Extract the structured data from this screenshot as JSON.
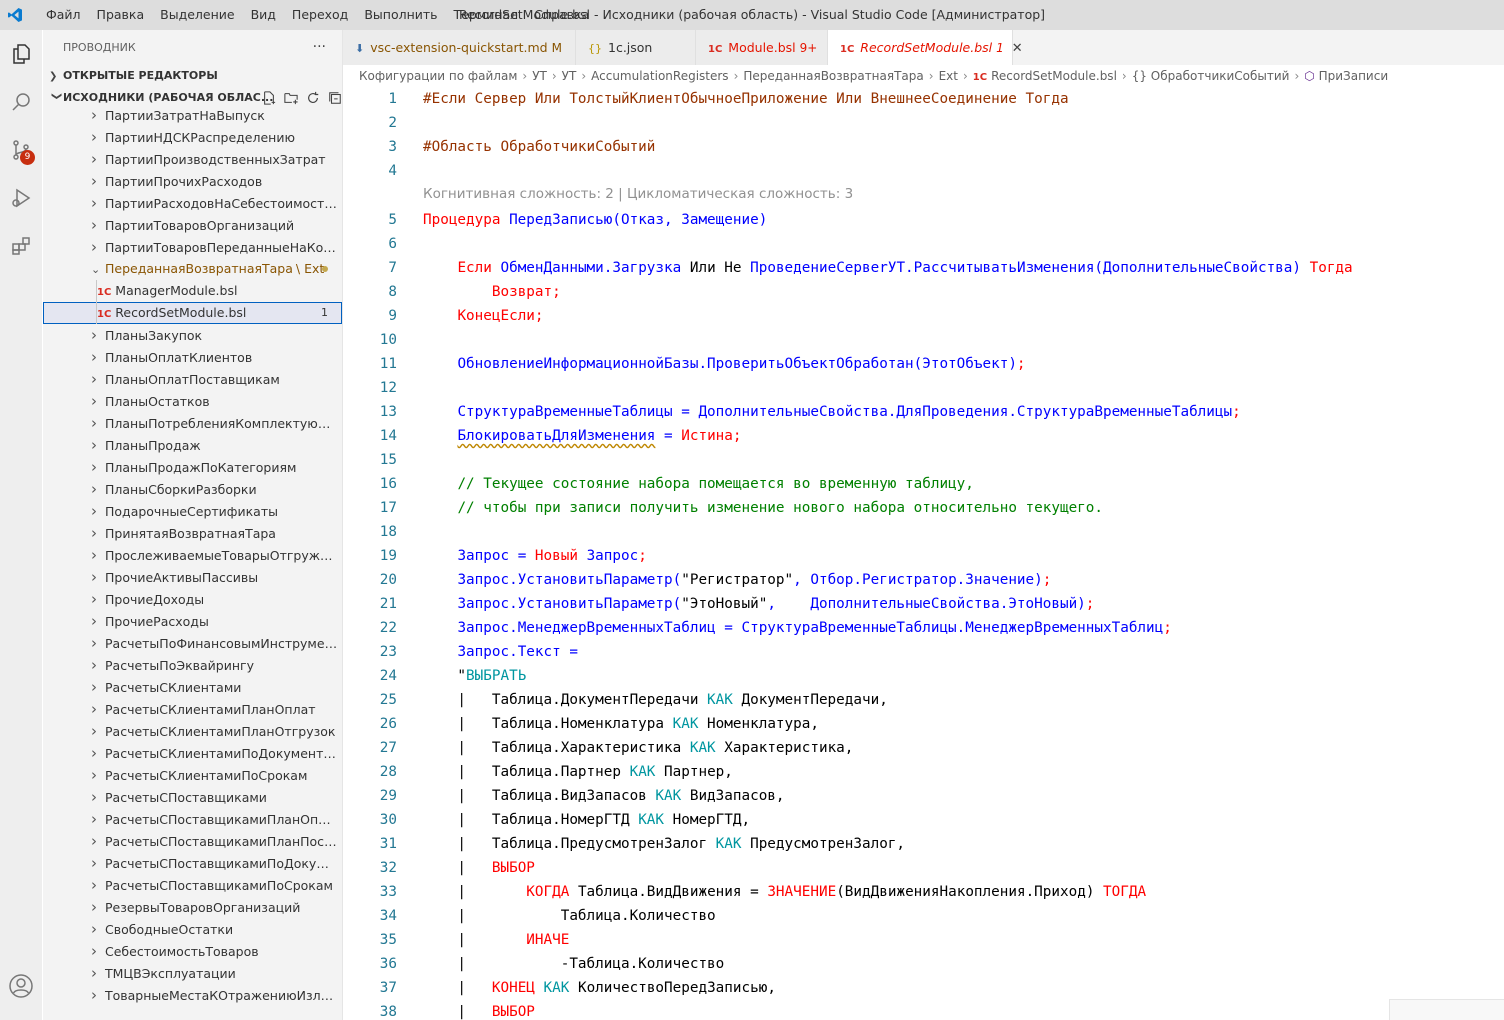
{
  "titlebar": {
    "menu": [
      "Файл",
      "Правка",
      "Выделение",
      "Вид",
      "Переход",
      "Выполнить",
      "Терминал",
      "Справка"
    ],
    "title": "RecordSetModule.bsl - Исходники (рабочая область) - Visual Studio Code [Администратор]"
  },
  "activity": {
    "scm_badge": "9"
  },
  "sidebar": {
    "title": "ПРОВОДНИК",
    "open_editors": "ОТКРЫТЫЕ РЕДАКТОРЫ",
    "workspace": "ИСХОДНИКИ (РАБОЧАЯ ОБЛАС...",
    "items": [
      {
        "label": "ПартииЗатратНаВыпуск",
        "kind": "folder"
      },
      {
        "label": "ПартииНДСКРаспределению",
        "kind": "folder"
      },
      {
        "label": "ПартииПроизводственныхЗатрат",
        "kind": "folder"
      },
      {
        "label": "ПартииПрочихРасходов",
        "kind": "folder"
      },
      {
        "label": "ПартииРасходовНаСебестоимостьТо...",
        "kind": "folder"
      },
      {
        "label": "ПартииТоваровОрганизаций",
        "kind": "folder"
      },
      {
        "label": "ПартииТоваровПереданныеНаКомис...",
        "kind": "folder"
      },
      {
        "label": "ПереданнаяВозвратнаяТара",
        "kind": "open-folder",
        "suffix": "\\ Ext"
      },
      {
        "label": "ManagerModule.bsl",
        "kind": "file"
      },
      {
        "label": "RecordSetModule.bsl",
        "kind": "file-selected",
        "count": "1"
      },
      {
        "label": "ПланыЗакупок",
        "kind": "folder"
      },
      {
        "label": "ПланыОплатКлиентов",
        "kind": "folder"
      },
      {
        "label": "ПланыОплатПоставщикам",
        "kind": "folder"
      },
      {
        "label": "ПланыОстатков",
        "kind": "folder"
      },
      {
        "label": "ПланыПотребленияКомплектующих",
        "kind": "folder"
      },
      {
        "label": "ПланыПродаж",
        "kind": "folder"
      },
      {
        "label": "ПланыПродажПоКатегориям",
        "kind": "folder"
      },
      {
        "label": "ПланыСборкиРазборки",
        "kind": "folder"
      },
      {
        "label": "ПодарочныеСертификаты",
        "kind": "folder"
      },
      {
        "label": "ПринятаяВозвратнаяТара",
        "kind": "folder"
      },
      {
        "label": "ПрослеживаемыеТоварыОтгруженн...",
        "kind": "folder"
      },
      {
        "label": "ПрочиеАктивыПассивы",
        "kind": "folder"
      },
      {
        "label": "ПрочиеДоходы",
        "kind": "folder"
      },
      {
        "label": "ПрочиеРасходы",
        "kind": "folder"
      },
      {
        "label": "РасчетыПоФинансовымИнструментам",
        "kind": "folder"
      },
      {
        "label": "РасчетыПоЭквайрингу",
        "kind": "folder"
      },
      {
        "label": "РасчетыСКлиентами",
        "kind": "folder"
      },
      {
        "label": "РасчетыСКлиентамиПланОплат",
        "kind": "folder"
      },
      {
        "label": "РасчетыСКлиентамиПланОтгрузок",
        "kind": "folder"
      },
      {
        "label": "РасчетыСКлиентамиПоДокументам",
        "kind": "folder"
      },
      {
        "label": "РасчетыСКлиентамиПоСрокам",
        "kind": "folder"
      },
      {
        "label": "РасчетыСПоставщиками",
        "kind": "folder"
      },
      {
        "label": "РасчетыСПоставщикамиПланОплат",
        "kind": "folder"
      },
      {
        "label": "РасчетыСПоставщикамиПланПоставок",
        "kind": "folder"
      },
      {
        "label": "РасчетыСПоставщикамиПоДокумент...",
        "kind": "folder"
      },
      {
        "label": "РасчетыСПоставщикамиПоСрокам",
        "kind": "folder"
      },
      {
        "label": "РезервыТоваровОрганизаций",
        "kind": "folder"
      },
      {
        "label": "СвободныеОстатки",
        "kind": "folder"
      },
      {
        "label": "СебестоимостьТоваров",
        "kind": "folder"
      },
      {
        "label": "ТМЦВЭксплуатации",
        "kind": "folder"
      },
      {
        "label": "ТоварныеМестаКОтражениюИзлишк...",
        "kind": "folder"
      }
    ]
  },
  "tabs": [
    {
      "label": "vsc-extension-quickstart.md",
      "flag": "M",
      "icon": "download-icon"
    },
    {
      "label": "1c.json",
      "flag": "",
      "icon": "json-icon"
    },
    {
      "label": "Module.bsl",
      "flag": "9+",
      "icon": "onec-icon"
    },
    {
      "label": "RecordSetModule.bsl",
      "flag": "1",
      "icon": "onec-icon",
      "active": true
    }
  ],
  "breadcrumb": [
    "Кофигурации по файлам",
    "УТ",
    "УТ",
    "AccumulationRegisters",
    "ПереданнаяВозвратнаяТара",
    "Ext",
    "RecordSetModule.bsl",
    "{} ОбработчикиСобытий",
    "ПриЗаписи"
  ],
  "editor": {
    "codelens": "Когнитивная сложность: 2 | Цикломатическая сложность: 3",
    "lines": [
      {
        "n": "1",
        "t": [
          [
            "k-pre",
            "#Если Сервер Или ТолстыйКлиентОбычноеПриложение Или ВнешнееСоединение Тогда"
          ]
        ]
      },
      {
        "n": "2",
        "t": []
      },
      {
        "n": "3",
        "t": [
          [
            "k-pre",
            "#Область ОбработчикиСобытий"
          ]
        ]
      },
      {
        "n": "4",
        "t": []
      },
      {
        "n": "5",
        "t": [
          [
            "k-red",
            "Процедура "
          ],
          [
            "k-blue",
            "ПередЗаписью(Отказ, Замещение)"
          ]
        ]
      },
      {
        "n": "6",
        "t": []
      },
      {
        "n": "7",
        "t": [
          [
            "k-dark",
            "    "
          ],
          [
            "k-red",
            "Если "
          ],
          [
            "k-blue",
            "ОбменДанными.Загрузка "
          ],
          [
            "k-dark",
            "Или Не "
          ],
          [
            "k-blue",
            "ПроведениеСервerУТ.РассчитыватьИзменения(ДополнительныеСвойства) "
          ],
          [
            "k-red",
            "Тогда"
          ]
        ]
      },
      {
        "n": "8",
        "t": [
          [
            "k-dark",
            "        "
          ],
          [
            "k-red",
            "Возврат;"
          ]
        ]
      },
      {
        "n": "9",
        "t": [
          [
            "k-dark",
            "    "
          ],
          [
            "k-red",
            "КонецЕсли;"
          ]
        ]
      },
      {
        "n": "10",
        "t": []
      },
      {
        "n": "11",
        "t": [
          [
            "k-dark",
            "    "
          ],
          [
            "k-blue",
            "ОбновлениеИнформационнойБазы.ПроверитьОбъектОбработан(ЭтотОбъект)"
          ],
          [
            "k-red",
            ";"
          ]
        ]
      },
      {
        "n": "12",
        "t": []
      },
      {
        "n": "13",
        "t": [
          [
            "k-dark",
            "    "
          ],
          [
            "k-blue",
            "СтруктураВременныеТаблицы = ДополнительныеСвойства.ДляПроведения.СтруктураВременныеТаблицы"
          ],
          [
            "k-red",
            ";"
          ]
        ]
      },
      {
        "n": "14",
        "t": [
          [
            "k-dark",
            "    "
          ],
          [
            "k-blue squiggle",
            "БлокироватьДляИзменения"
          ],
          [
            "k-blue",
            " = "
          ],
          [
            "k-red",
            "Истина;"
          ]
        ]
      },
      {
        "n": "15",
        "t": []
      },
      {
        "n": "16",
        "t": [
          [
            "k-dark",
            "    "
          ],
          [
            "k-green",
            "// Текущее состояние набора помещается во временную таблицу,"
          ]
        ]
      },
      {
        "n": "17",
        "t": [
          [
            "k-dark",
            "    "
          ],
          [
            "k-green",
            "// чтобы при записи получить изменение нового набора относительно текущего."
          ]
        ]
      },
      {
        "n": "18",
        "t": []
      },
      {
        "n": "19",
        "t": [
          [
            "k-dark",
            "    "
          ],
          [
            "k-blue",
            "Запрос = "
          ],
          [
            "k-red",
            "Новый "
          ],
          [
            "k-blue",
            "Запрос"
          ],
          [
            "k-red",
            ";"
          ]
        ]
      },
      {
        "n": "20",
        "t": [
          [
            "k-dark",
            "    "
          ],
          [
            "k-blue",
            "Запрос.УстановитьПараметр("
          ],
          [
            "k-dark",
            "\"Регистратор\""
          ],
          [
            "k-blue",
            ", Отбор.Регистратор.Значение)"
          ],
          [
            "k-red",
            ";"
          ]
        ]
      },
      {
        "n": "21",
        "t": [
          [
            "k-dark",
            "    "
          ],
          [
            "k-blue",
            "Запрос.УстановитьПараметр("
          ],
          [
            "k-dark",
            "\"ЭтоНовый\""
          ],
          [
            "k-blue",
            ",    ДополнительныеСвойства.ЭтоНовый)"
          ],
          [
            "k-red",
            ";"
          ]
        ]
      },
      {
        "n": "22",
        "t": [
          [
            "k-dark",
            "    "
          ],
          [
            "k-blue",
            "Запрос.МенеджерВременныхТаблиц = СтруктураВременныеТаблицы.МенеджерВременныхТаблиц"
          ],
          [
            "k-red",
            ";"
          ]
        ]
      },
      {
        "n": "23",
        "t": [
          [
            "k-dark",
            "    "
          ],
          [
            "k-blue",
            "Запрос.Текст ="
          ]
        ]
      },
      {
        "n": "24",
        "t": [
          [
            "k-dark",
            "    \""
          ],
          [
            "k-teal",
            "ВЫБРАТЬ"
          ]
        ]
      },
      {
        "n": "25",
        "t": [
          [
            "k-dark",
            "    |   Таблица.ДокументПередачи "
          ],
          [
            "k-teal",
            "КАК"
          ],
          [
            "k-dark",
            " ДокументПередачи,"
          ]
        ]
      },
      {
        "n": "26",
        "t": [
          [
            "k-dark",
            "    |   Таблица.Номенклатура "
          ],
          [
            "k-teal",
            "КАК"
          ],
          [
            "k-dark",
            " Номенклатура,"
          ]
        ]
      },
      {
        "n": "27",
        "t": [
          [
            "k-dark",
            "    |   Таблица.Характеристика "
          ],
          [
            "k-teal",
            "КАК"
          ],
          [
            "k-dark",
            " Характеристика,"
          ]
        ]
      },
      {
        "n": "28",
        "t": [
          [
            "k-dark",
            "    |   Таблица.Партнер "
          ],
          [
            "k-teal",
            "КАК"
          ],
          [
            "k-dark",
            " Партнер,"
          ]
        ]
      },
      {
        "n": "29",
        "t": [
          [
            "k-dark",
            "    |   Таблица.ВидЗапасов "
          ],
          [
            "k-teal",
            "КАК"
          ],
          [
            "k-dark",
            " ВидЗапасов,"
          ]
        ]
      },
      {
        "n": "30",
        "t": [
          [
            "k-dark",
            "    |   Таблица.НомерГТД "
          ],
          [
            "k-teal",
            "КАК"
          ],
          [
            "k-dark",
            " НомерГТД,"
          ]
        ]
      },
      {
        "n": "31",
        "t": [
          [
            "k-dark",
            "    |   Таблица.ПредусмотренЗалог "
          ],
          [
            "k-teal",
            "КАК"
          ],
          [
            "k-dark",
            " ПредусмотренЗалог,"
          ]
        ]
      },
      {
        "n": "32",
        "t": [
          [
            "k-dark",
            "    |   "
          ],
          [
            "k-red",
            "ВЫБОР"
          ]
        ]
      },
      {
        "n": "33",
        "t": [
          [
            "k-dark",
            "    |       "
          ],
          [
            "k-red",
            "КОГДА"
          ],
          [
            "k-dark",
            " Таблица.ВидДвижения = "
          ],
          [
            "k-red",
            "ЗНАЧЕНИЕ"
          ],
          [
            "k-dark",
            "(ВидДвиженияНакопления.Приход) "
          ],
          [
            "k-red",
            "ТОГДА"
          ]
        ]
      },
      {
        "n": "34",
        "t": [
          [
            "k-dark",
            "    |           Таблица.Количество"
          ]
        ]
      },
      {
        "n": "35",
        "t": [
          [
            "k-dark",
            "    |       "
          ],
          [
            "k-red",
            "ИНАЧЕ"
          ]
        ]
      },
      {
        "n": "36",
        "t": [
          [
            "k-dark",
            "    |           -Таблица.Количество"
          ]
        ]
      },
      {
        "n": "37",
        "t": [
          [
            "k-dark",
            "    |   "
          ],
          [
            "k-red",
            "КОНЕЦ"
          ],
          [
            "k-dark",
            " "
          ],
          [
            "k-teal",
            "КАК"
          ],
          [
            "k-dark",
            " КоличествоПередЗаписью,"
          ]
        ]
      },
      {
        "n": "38",
        "t": [
          [
            "k-dark",
            "    |   "
          ],
          [
            "k-red",
            "ВЫБОР"
          ]
        ]
      }
    ]
  }
}
